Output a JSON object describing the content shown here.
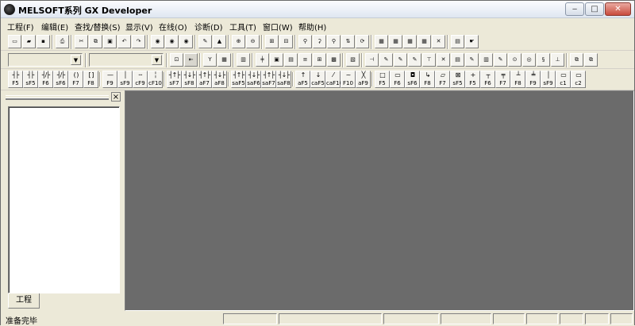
{
  "window": {
    "title": "MELSOFT系列 GX Developer",
    "minimize": "‒",
    "maximize": "□",
    "close": "✕"
  },
  "menu": [
    {
      "id": "project",
      "label": "工程(F)"
    },
    {
      "id": "edit",
      "label": "编辑(E)"
    },
    {
      "id": "find",
      "label": "查找/替换(S)"
    },
    {
      "id": "view",
      "label": "显示(V)"
    },
    {
      "id": "online",
      "label": "在线(O)"
    },
    {
      "id": "diagnostics",
      "label": "诊断(D)"
    },
    {
      "id": "tools",
      "label": "工具(T)"
    },
    {
      "id": "window",
      "label": "窗口(W)"
    },
    {
      "id": "help",
      "label": "帮助(H)"
    }
  ],
  "toolbar1": [
    {
      "id": "new",
      "glyph": "▭"
    },
    {
      "id": "open",
      "glyph": "▰"
    },
    {
      "id": "save",
      "glyph": "▪"
    },
    {
      "sep": true
    },
    {
      "id": "print",
      "glyph": "⎙"
    },
    {
      "sep": true
    },
    {
      "id": "cut",
      "glyph": "✂"
    },
    {
      "id": "copy",
      "glyph": "⧉"
    },
    {
      "id": "paste",
      "glyph": "▣"
    },
    {
      "id": "undo",
      "glyph": "↶"
    },
    {
      "id": "redo",
      "glyph": "↷"
    },
    {
      "sep": true
    },
    {
      "id": "plc-read",
      "glyph": "◉"
    },
    {
      "id": "plc-write",
      "glyph": "◉"
    },
    {
      "id": "verify",
      "glyph": "◉"
    },
    {
      "sep": true
    },
    {
      "id": "monitor",
      "glyph": "✎"
    },
    {
      "id": "monitor-stop",
      "glyph": "▲"
    },
    {
      "sep": true
    },
    {
      "id": "zoom-in",
      "glyph": "⊕"
    },
    {
      "id": "zoom-out",
      "glyph": "⊖"
    },
    {
      "sep": true
    },
    {
      "id": "device-entry",
      "glyph": "⊞"
    },
    {
      "id": "device-test",
      "glyph": "⊟"
    },
    {
      "sep": true
    },
    {
      "id": "find-device",
      "glyph": "⚲"
    },
    {
      "id": "find-instr",
      "glyph": "⚳"
    },
    {
      "id": "find-contact",
      "glyph": "⚲"
    },
    {
      "id": "cross-ref",
      "glyph": "⇅"
    },
    {
      "id": "replace",
      "glyph": "⟳"
    },
    {
      "sep": true
    },
    {
      "id": "mon-1",
      "glyph": "▦"
    },
    {
      "id": "mon-2",
      "glyph": "▦"
    },
    {
      "id": "mon-3",
      "glyph": "▦"
    },
    {
      "id": "mon-4",
      "glyph": "▦"
    },
    {
      "id": "mon-5",
      "glyph": "✕"
    },
    {
      "sep": true
    },
    {
      "id": "tool-1",
      "glyph": "▤"
    },
    {
      "id": "tool-2",
      "glyph": "☛"
    }
  ],
  "toolbar2": [
    {
      "id": "program-combo",
      "type": "combo",
      "w": 94
    },
    {
      "sep": true
    },
    {
      "id": "param-combo",
      "type": "combo",
      "w": 94
    },
    {
      "sep": true
    },
    {
      "id": "pb1",
      "glyph": "⊡"
    },
    {
      "id": "pb2",
      "glyph": "⇤",
      "dk": true
    },
    {
      "sep": true
    },
    {
      "id": "pb3",
      "glyph": "Y"
    },
    {
      "id": "pb4",
      "glyph": "▦"
    },
    {
      "sep": true
    },
    {
      "id": "pb5",
      "glyph": "▥"
    },
    {
      "sep": true
    },
    {
      "id": "pb6",
      "glyph": "╪"
    },
    {
      "id": "pb7",
      "glyph": "▣"
    },
    {
      "id": "pb8",
      "glyph": "▤"
    },
    {
      "id": "pb9",
      "glyph": "≡"
    },
    {
      "id": "pb10",
      "glyph": "⊞"
    },
    {
      "id": "pb11",
      "glyph": "▩"
    },
    {
      "sep": true
    },
    {
      "id": "pb12",
      "glyph": "▧"
    },
    {
      "sep": true
    },
    {
      "id": "pb13",
      "glyph": "⊣"
    },
    {
      "id": "pb14",
      "glyph": "✎"
    },
    {
      "id": "pb15",
      "glyph": "✎"
    },
    {
      "id": "pb16",
      "glyph": "✎"
    },
    {
      "id": "pb17",
      "glyph": "⊤"
    },
    {
      "id": "pb18",
      "glyph": "✕"
    },
    {
      "id": "pb19",
      "glyph": "▤"
    },
    {
      "id": "pb20",
      "glyph": "✎"
    },
    {
      "id": "pb21",
      "glyph": "▥"
    },
    {
      "id": "pb22",
      "glyph": "✎"
    },
    {
      "id": "pb23",
      "glyph": "⊙"
    },
    {
      "id": "pb24",
      "glyph": "◎"
    },
    {
      "id": "pb25",
      "glyph": "§"
    },
    {
      "id": "pb26",
      "glyph": "⊥"
    },
    {
      "sep": true
    },
    {
      "id": "pb27",
      "glyph": "⧉"
    },
    {
      "id": "pb28",
      "glyph": "⧉"
    }
  ],
  "ladder_toolbar": [
    {
      "id": "ladder-open-contact",
      "sym": "┤├",
      "key": "F5"
    },
    {
      "id": "ladder-open-contact-parallel",
      "sym": "┤├",
      "key": "sF5"
    },
    {
      "id": "ladder-closed-contact",
      "sym": "┤/├",
      "key": "F6"
    },
    {
      "id": "ladder-closed-contact-parallel",
      "sym": "┤/├",
      "key": "sF6"
    },
    {
      "id": "ladder-coil",
      "sym": "( )",
      "key": "F7"
    },
    {
      "id": "ladder-application-instruction",
      "sym": "[ ]",
      "key": "F8"
    },
    {
      "sep": true
    },
    {
      "id": "ladder-horizontal-line",
      "sym": "—",
      "key": "F9"
    },
    {
      "id": "ladder-vertical-line",
      "sym": "│",
      "key": "sF9"
    },
    {
      "id": "ladder-delete-horizontal",
      "sym": "╌",
      "key": "cF9"
    },
    {
      "id": "ladder-delete-vertical",
      "sym": "╎",
      "key": "cF10"
    },
    {
      "sep": true
    },
    {
      "id": "ladder-rising-pulse",
      "sym": "┤↑├",
      "key": "sF7"
    },
    {
      "id": "ladder-falling-pulse",
      "sym": "┤↓├",
      "key": "sF8"
    },
    {
      "id": "ladder-rising-pulse-parallel",
      "sym": "┤↑├",
      "key": "aF7"
    },
    {
      "id": "ladder-falling-pulse-parallel",
      "sym": "┤↓├",
      "key": "aF8"
    },
    {
      "sep": true
    },
    {
      "id": "ladder-pulse-5",
      "sym": "┤↑├",
      "key": "saF5"
    },
    {
      "id": "ladder-pulse-6",
      "sym": "┤↓├",
      "key": "saF6"
    },
    {
      "id": "ladder-pulse-7",
      "sym": "┤↑├",
      "key": "saF7"
    },
    {
      "id": "ladder-pulse-8",
      "sym": "┤↓├",
      "key": "saF8"
    },
    {
      "sep": true
    },
    {
      "id": "ladder-invert-up",
      "sym": "↑",
      "key": "aF5"
    },
    {
      "id": "ladder-invert-down",
      "sym": "↓",
      "key": "caF5"
    },
    {
      "id": "ladder-operation-result",
      "sym": "⁄",
      "key": "caF10"
    },
    {
      "id": "ladder-draw-line",
      "sym": "~",
      "key": "F10"
    },
    {
      "id": "ladder-delete-line",
      "sym": "╳",
      "key": "aF9"
    },
    {
      "sep": true
    },
    {
      "id": "sfc-step",
      "sym": "□",
      "key": "F5"
    },
    {
      "id": "sfc-block-start",
      "sym": "▭",
      "key": "F6"
    },
    {
      "id": "sfc-end-step",
      "sym": "◘",
      "key": "sF6"
    },
    {
      "id": "sfc-jump",
      "sym": "↳",
      "key": "F8"
    },
    {
      "id": "sfc-end",
      "sym": "▱",
      "key": "F7"
    },
    {
      "id": "sfc-dummy",
      "sym": "⊠",
      "key": "sF5"
    },
    {
      "id": "sfc-transition",
      "sym": "+",
      "key": "F5"
    },
    {
      "id": "sfc-selective-branch",
      "sym": "┬",
      "key": "F6"
    },
    {
      "id": "sfc-parallel-branch",
      "sym": "╤",
      "key": "F7"
    },
    {
      "id": "sfc-selective-coupling",
      "sym": "┴",
      "key": "F8"
    },
    {
      "id": "sfc-parallel-coupling",
      "sym": "╧",
      "key": "F9"
    },
    {
      "id": "sfc-vertical-line",
      "sym": "│",
      "key": "sF9"
    },
    {
      "id": "sfc-comment",
      "sym": "▭",
      "key": "c1"
    },
    {
      "id": "sfc-more",
      "sym": "▭",
      "key": "c2"
    }
  ],
  "project_panel": {
    "close": "×",
    "tab": "工程"
  },
  "status": {
    "text": "准备完毕"
  }
}
